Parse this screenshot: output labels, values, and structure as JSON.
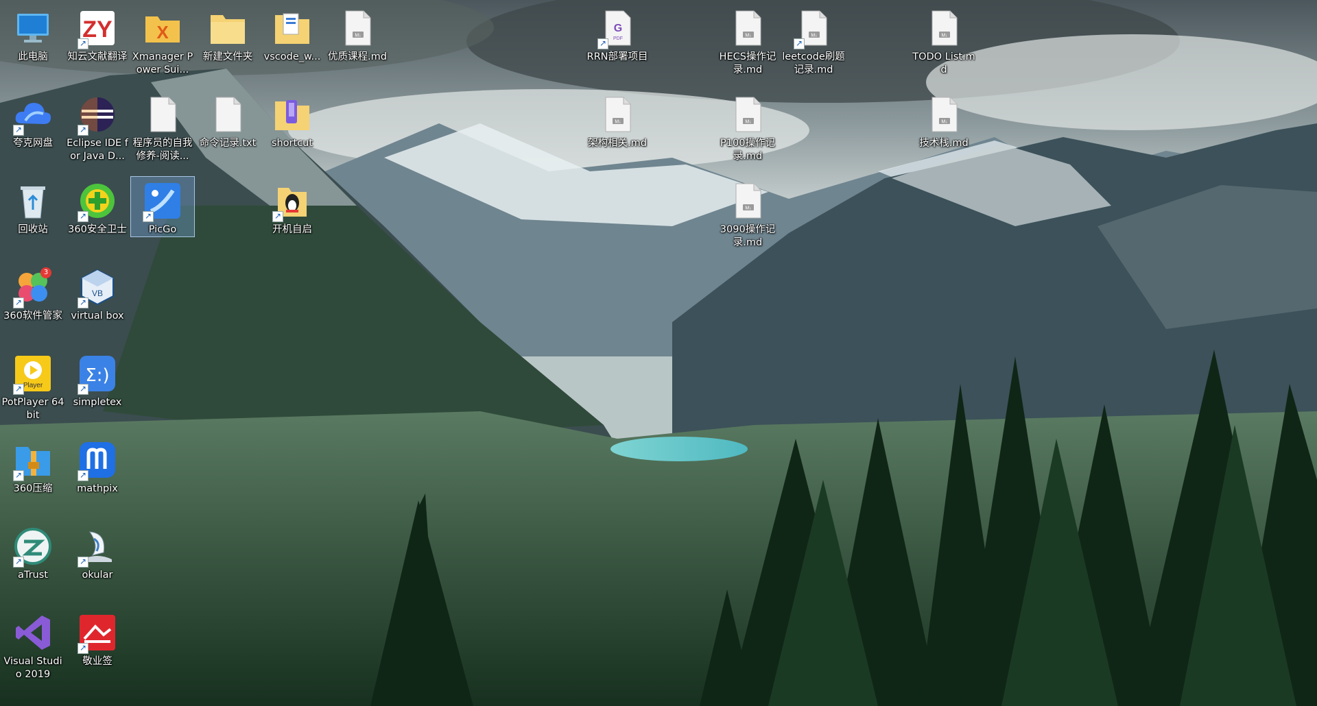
{
  "desktop": {
    "wallpaper": "mountain-lake-valley",
    "icons": [
      {
        "label": "此电脑",
        "icon": "computer-icon",
        "shortcut": false
      },
      {
        "label": "知云文献翻译",
        "icon": "zy-app-icon",
        "shortcut": true
      },
      {
        "label": "Xmanager Power Sui...",
        "icon": "xmanager-icon",
        "shortcut": false
      },
      {
        "label": "新建文件夹",
        "icon": "folder-icon",
        "shortcut": false
      },
      {
        "label": "vscode_w...",
        "icon": "folder-docs-icon",
        "shortcut": false
      },
      {
        "label": "优质课程.md",
        "icon": "markdown-file-icon",
        "shortcut": false
      },
      {
        "label": "RRN部署项目",
        "icon": "pdf-file-icon",
        "shortcut": true
      },
      {
        "label": "HECS操作记录.md",
        "icon": "markdown-file-icon",
        "shortcut": false
      },
      {
        "label": "leetcode刷题记录.md",
        "icon": "markdown-file-icon",
        "shortcut": true
      },
      {
        "label": "TODO List.md",
        "icon": "markdown-file-icon",
        "shortcut": false
      },
      {
        "label": "夸克网盘",
        "icon": "cloud-icon",
        "shortcut": true
      },
      {
        "label": "Eclipse IDE for Java D...",
        "icon": "eclipse-icon",
        "shortcut": true
      },
      {
        "label": "程序员的自我修养-阅读...",
        "icon": "text-file-icon",
        "shortcut": false
      },
      {
        "label": "命令记录.txt",
        "icon": "text-file-icon",
        "shortcut": false
      },
      {
        "label": "shortcut",
        "icon": "folder-shortcut-icon",
        "shortcut": false
      },
      {
        "label": "架构相关.md",
        "icon": "markdown-file-icon",
        "shortcut": false
      },
      {
        "label": "P100操作记录.md",
        "icon": "markdown-file-icon",
        "shortcut": false
      },
      {
        "label": "技术栈.md",
        "icon": "markdown-file-icon",
        "shortcut": false
      },
      {
        "label": "回收站",
        "icon": "recycle-bin-icon",
        "shortcut": false
      },
      {
        "label": "360安全卫士",
        "icon": "360-guard-icon",
        "shortcut": true
      },
      {
        "label": "PicGo",
        "icon": "picgo-icon",
        "shortcut": true
      },
      {
        "label": "开机自启",
        "icon": "qq-folder-icon",
        "shortcut": true
      },
      {
        "label": "3090操作记录.md",
        "icon": "markdown-file-icon",
        "shortcut": false
      },
      {
        "label": "360软件管家",
        "icon": "360-softmgr-icon",
        "shortcut": true,
        "badge": "3"
      },
      {
        "label": "virtual box",
        "icon": "virtualbox-icon",
        "shortcut": true
      },
      {
        "label": "PotPlayer 64 bit",
        "icon": "potplayer-icon",
        "shortcut": true
      },
      {
        "label": "simpletex",
        "icon": "simpletex-icon",
        "shortcut": true
      },
      {
        "label": "360压缩",
        "icon": "360-zip-icon",
        "shortcut": true
      },
      {
        "label": "mathpix",
        "icon": "mathpix-icon",
        "shortcut": true
      },
      {
        "label": "aTrust",
        "icon": "atrust-icon",
        "shortcut": true
      },
      {
        "label": "okular",
        "icon": "okular-icon",
        "shortcut": true
      },
      {
        "label": "Visual Studio 2019",
        "icon": "visual-studio-icon",
        "shortcut": false
      },
      {
        "label": "敬业签",
        "icon": "jingyeqian-icon",
        "shortcut": true
      }
    ],
    "colors": {
      "sky_top": "#5c6b70",
      "sky_mid": "#c9d2d1",
      "mountain": "#3f5560",
      "forest": "#1f3a27",
      "lake": "#5fc4c8"
    }
  }
}
